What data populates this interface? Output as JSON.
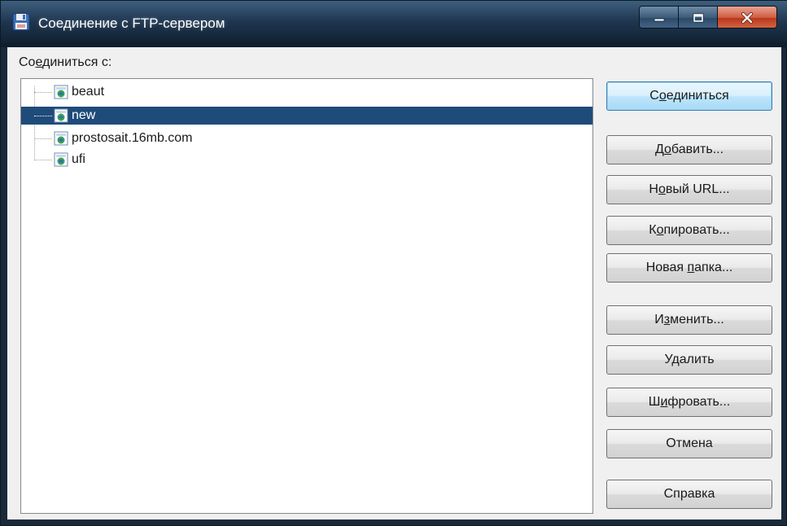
{
  "window": {
    "title": "Соединение с FTP-сервером",
    "icon": "floppy-disk-icon"
  },
  "dialog": {
    "connect_label": "Соединиться с:",
    "tree_items": [
      {
        "label": "beaut",
        "icon": "server-icon",
        "selected": false
      },
      {
        "label": "new",
        "icon": "server-icon",
        "selected": true
      },
      {
        "label": "prostosait.16mb.com",
        "icon": "server-icon",
        "selected": false
      },
      {
        "label": "ufi",
        "icon": "server-icon",
        "selected": false
      }
    ],
    "buttons": {
      "connect": "Соединиться",
      "add": "Добавить...",
      "new_url": "Новый URL...",
      "copy": "Копировать...",
      "new_folder": "Новая папка...",
      "edit": "Изменить...",
      "delete": "Удалить",
      "encrypt": "Шифровать...",
      "cancel": "Отмена",
      "help": "Справка"
    }
  },
  "colors": {
    "titlebar": "#1f3650",
    "selection": "#1f4b7a",
    "close_button": "#cf5a3e",
    "default_button": "#bee6fd"
  }
}
